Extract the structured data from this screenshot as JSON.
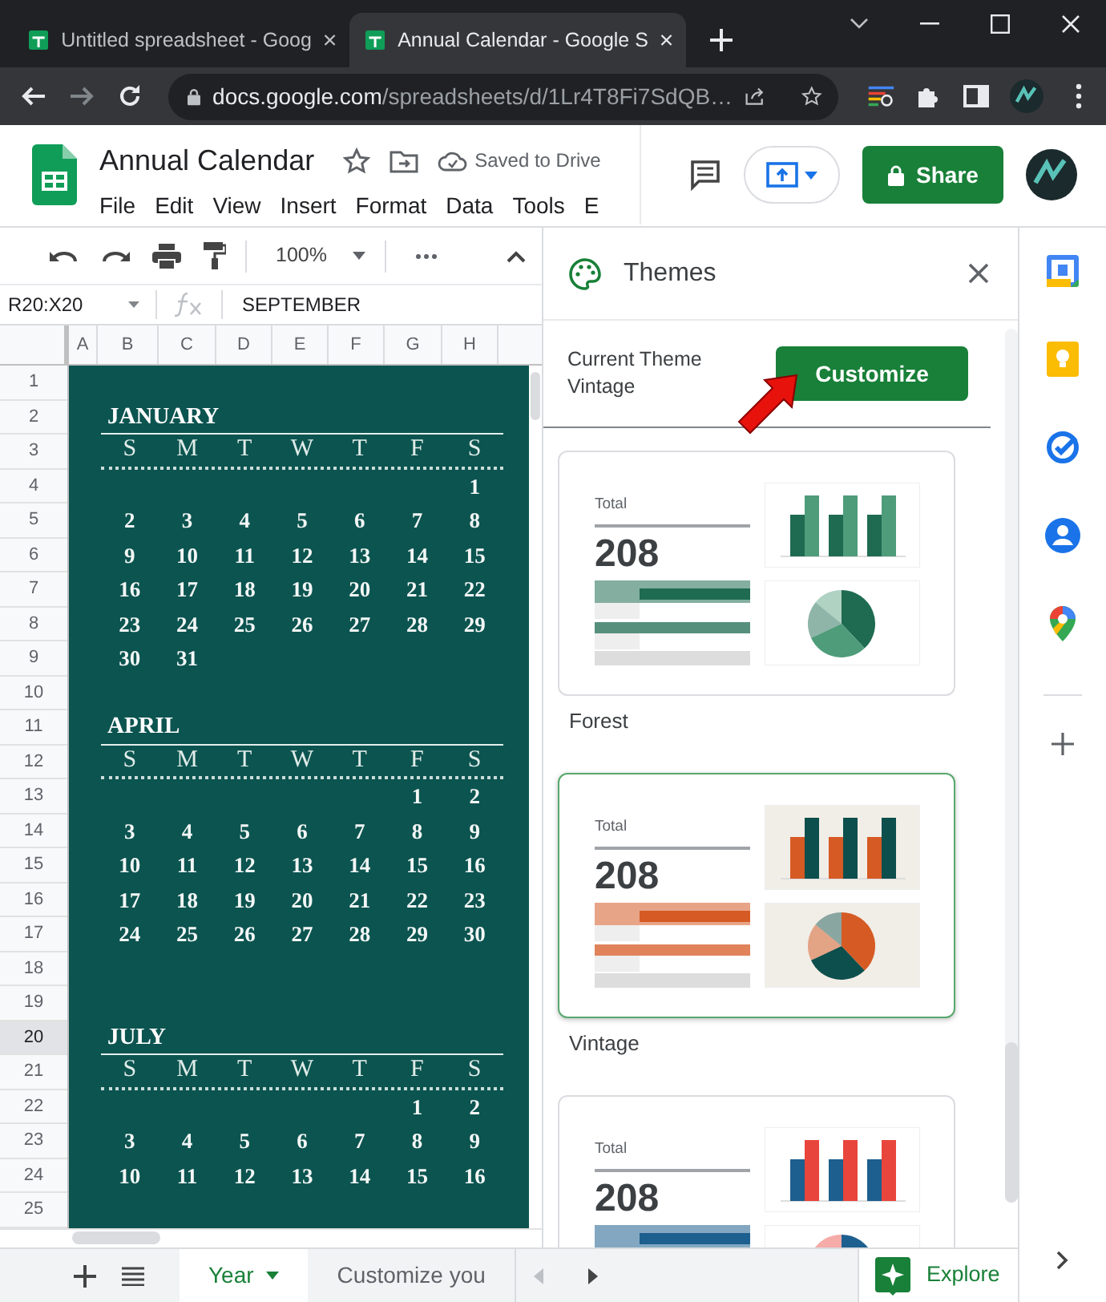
{
  "browser": {
    "tabs": [
      {
        "title": "Untitled spreadsheet - Goog",
        "selected": false
      },
      {
        "title": "Annual Calendar - Google S",
        "selected": true
      }
    ],
    "url_host": "docs.google.com",
    "url_path": "/spreadsheets/d/1Lr4T8Fi7SdQB…"
  },
  "document": {
    "title": "Annual Calendar",
    "save_status": "Saved to Drive",
    "share_label": "Share",
    "menu": [
      "File",
      "Edit",
      "View",
      "Insert",
      "Format",
      "Data",
      "Tools",
      "E"
    ]
  },
  "toolbar": {
    "zoom": "100%"
  },
  "formula_bar": {
    "cell_ref": "R20:X20",
    "value": "SEPTEMBER"
  },
  "columns": [
    "A",
    "B",
    "C",
    "D",
    "E",
    "F",
    "G",
    "H"
  ],
  "rows": [
    {
      "label": "1",
      "selected": false
    },
    {
      "label": "2",
      "selected": false
    },
    {
      "label": "3",
      "selected": false
    },
    {
      "label": "4",
      "selected": false
    },
    {
      "label": "5",
      "selected": false
    },
    {
      "label": "6",
      "selected": false
    },
    {
      "label": "7",
      "selected": false
    },
    {
      "label": "8",
      "selected": false
    },
    {
      "label": "9",
      "selected": false
    },
    {
      "label": "10",
      "selected": false
    },
    {
      "label": "11",
      "selected": false
    },
    {
      "label": "12",
      "selected": false
    },
    {
      "label": "13",
      "selected": false
    },
    {
      "label": "14",
      "selected": false
    },
    {
      "label": "15",
      "selected": false
    },
    {
      "label": "16",
      "selected": false
    },
    {
      "label": "17",
      "selected": false
    },
    {
      "label": "18",
      "selected": false
    },
    {
      "label": "19",
      "selected": false
    },
    {
      "label": "20",
      "selected": true
    },
    {
      "label": "21",
      "selected": false
    },
    {
      "label": "22",
      "selected": false
    },
    {
      "label": "23",
      "selected": false
    },
    {
      "label": "24",
      "selected": false
    },
    {
      "label": "25",
      "selected": false
    }
  ],
  "calendar": {
    "months": [
      {
        "name": "JANUARY",
        "weekdays": [
          "S",
          "M",
          "T",
          "W",
          "T",
          "F",
          "S"
        ],
        "weeks": [
          [
            "1"
          ],
          [
            "2",
            "3",
            "4",
            "5",
            "6",
            "7",
            "8"
          ],
          [
            "9",
            "10",
            "11",
            "12",
            "13",
            "14",
            "15"
          ],
          [
            "16",
            "17",
            "18",
            "19",
            "20",
            "21",
            "22"
          ],
          [
            "23",
            "24",
            "25",
            "26",
            "27",
            "28",
            "29"
          ],
          [
            "30",
            "31"
          ]
        ]
      },
      {
        "name": "APRIL",
        "weekdays": [
          "S",
          "M",
          "T",
          "W",
          "T",
          "F",
          "S"
        ],
        "weeks": [
          [
            "1",
            "2"
          ],
          [
            "3",
            "4",
            "5",
            "6",
            "7",
            "8",
            "9"
          ],
          [
            "10",
            "11",
            "12",
            "13",
            "14",
            "15",
            "16"
          ],
          [
            "17",
            "18",
            "19",
            "20",
            "21",
            "22",
            "23"
          ],
          [
            "24",
            "25",
            "26",
            "27",
            "28",
            "29",
            "30"
          ]
        ]
      },
      {
        "name": "JULY",
        "weekdays": [
          "S",
          "M",
          "T",
          "W",
          "T",
          "F",
          "S"
        ],
        "weeks": [
          [
            "1",
            "2"
          ],
          [
            "3",
            "4",
            "5",
            "6",
            "7",
            "8",
            "9"
          ],
          [
            "10",
            "11",
            "12",
            "13",
            "14",
            "15",
            "16"
          ]
        ]
      }
    ]
  },
  "themes_panel": {
    "title": "Themes",
    "current_label": "Current Theme",
    "current_name": "Vintage",
    "customize_label": "Customize",
    "themes": [
      {
        "name": "Forest",
        "selected": false,
        "total_label": "Total",
        "total_value": "208",
        "palette": [
          {
            "color": "#1e6b52"
          },
          {
            "color": "#4e9c7a"
          },
          {
            "color": "#ffffff"
          }
        ]
      },
      {
        "name": "Vintage",
        "selected": true,
        "total_label": "Total",
        "total_value": "208",
        "palette": [
          {
            "color": "#d65a24"
          },
          {
            "color": "#0d4f4c"
          },
          {
            "color": "#f1ede7"
          }
        ]
      },
      {
        "selected": false,
        "total_label": "Total",
        "total_value": "208",
        "palette": [
          {
            "color": "#1d5f8e"
          },
          {
            "color": "#e8453c"
          },
          {
            "color": "#ffffff"
          }
        ]
      }
    ]
  },
  "sheet_tabs": [
    {
      "label": "Year",
      "selected": true
    },
    {
      "label": "Customize you",
      "selected": false
    }
  ],
  "explore_label": "Explore"
}
